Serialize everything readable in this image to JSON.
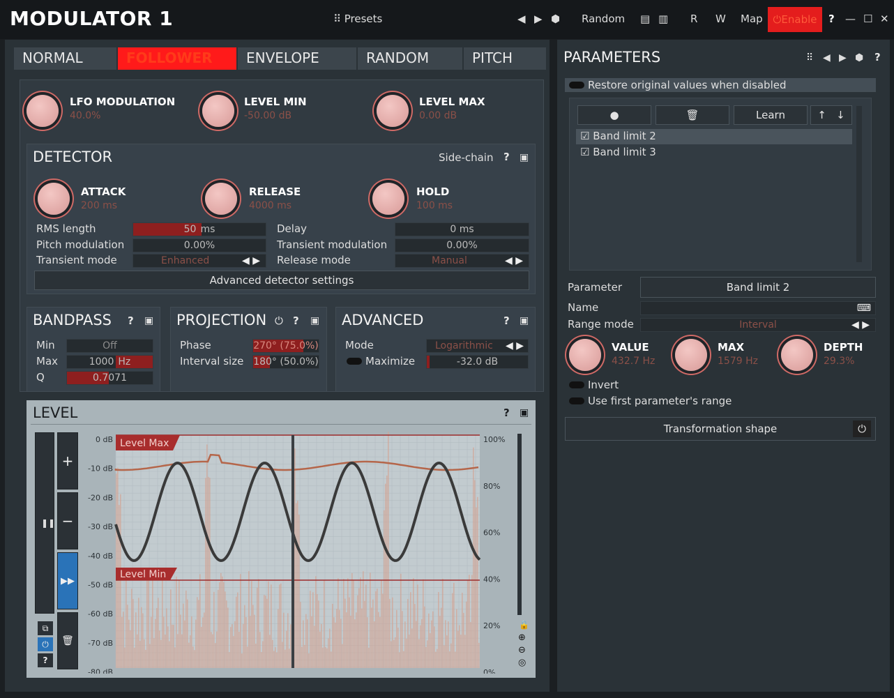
{
  "title": "MODULATOR 1",
  "toolbar": {
    "presets": "Presets",
    "random": "Random",
    "r": "R",
    "w": "W",
    "map": "Map",
    "enable": "Enable"
  },
  "tabs": [
    {
      "label": "NORMAL"
    },
    {
      "label": "FOLLOWER",
      "active": true
    },
    {
      "label": "ENVELOPE"
    },
    {
      "label": "RANDOM"
    },
    {
      "label": "PITCH"
    }
  ],
  "main_knobs": [
    {
      "label": "LFO MODULATION",
      "value": "40.0%"
    },
    {
      "label": "LEVEL MIN",
      "value": "-50.00 dB"
    },
    {
      "label": "LEVEL MAX",
      "value": "0.00 dB"
    }
  ],
  "detector": {
    "title": "DETECTOR",
    "sidechain": "Side-chain",
    "knobs": [
      {
        "label": "ATTACK",
        "value": "200 ms"
      },
      {
        "label": "RELEASE",
        "value": "4000 ms"
      },
      {
        "label": "HOLD",
        "value": "100 ms"
      }
    ],
    "rms_label": "RMS length",
    "rms_value": "50",
    "rms_unit": "ms",
    "delay_label": "Delay",
    "delay_value": "0 ms",
    "pitch_label": "Pitch modulation",
    "pitch_value": "0.00%",
    "transient_label": "Transient modulation",
    "transient_value": "0.00%",
    "tmode_label": "Transient mode",
    "tmode_value": "Enhanced",
    "rmode_label": "Release mode",
    "rmode_value": "Manual",
    "advanced_btn": "Advanced detector settings"
  },
  "bandpass": {
    "title": "BANDPASS",
    "min_label": "Min",
    "min_value": "Off",
    "max_label": "Max",
    "max_value": "1000",
    "max_unit": "Hz",
    "q_label": "Q",
    "q_value": "0.7071"
  },
  "projection": {
    "title": "PROJECTION",
    "phase_label": "Phase",
    "phase_value": "270° (75.0%)",
    "interval_label": "Interval size",
    "interval_value": "180° (50.0%)"
  },
  "advanced": {
    "title": "ADVANCED",
    "mode_label": "Mode",
    "mode_value": "Logarithmic",
    "maximize_label": "Maximize",
    "maximize_value": "-32.0 dB"
  },
  "level": {
    "title": "LEVEL",
    "db_ticks": [
      "0 dB",
      "-10 dB",
      "-20 dB",
      "-30 dB",
      "-40 dB",
      "-50 dB",
      "-60 dB",
      "-70 dB",
      "-80 dB"
    ],
    "pct_ticks": [
      "100%",
      "80%",
      "60%",
      "40%",
      "20%",
      "0%"
    ],
    "level_max": "Level Max",
    "level_min": "Level Min"
  },
  "parameters": {
    "title": "PARAMETERS",
    "restore": "Restore original values when disabled",
    "learn": "Learn",
    "items": [
      "Band limit 2",
      "Band limit 3"
    ],
    "param_label": "Parameter",
    "param_value": "Band limit 2",
    "name_label": "Name",
    "range_label": "Range mode",
    "range_value": "Interval",
    "knobs": [
      {
        "label": "VALUE",
        "value": "432.7 Hz"
      },
      {
        "label": "MAX",
        "value": "1579 Hz"
      },
      {
        "label": "DEPTH",
        "value": "29.3%"
      }
    ],
    "invert": "Invert",
    "use_first": "Use first parameter's range",
    "transform": "Transformation shape"
  }
}
